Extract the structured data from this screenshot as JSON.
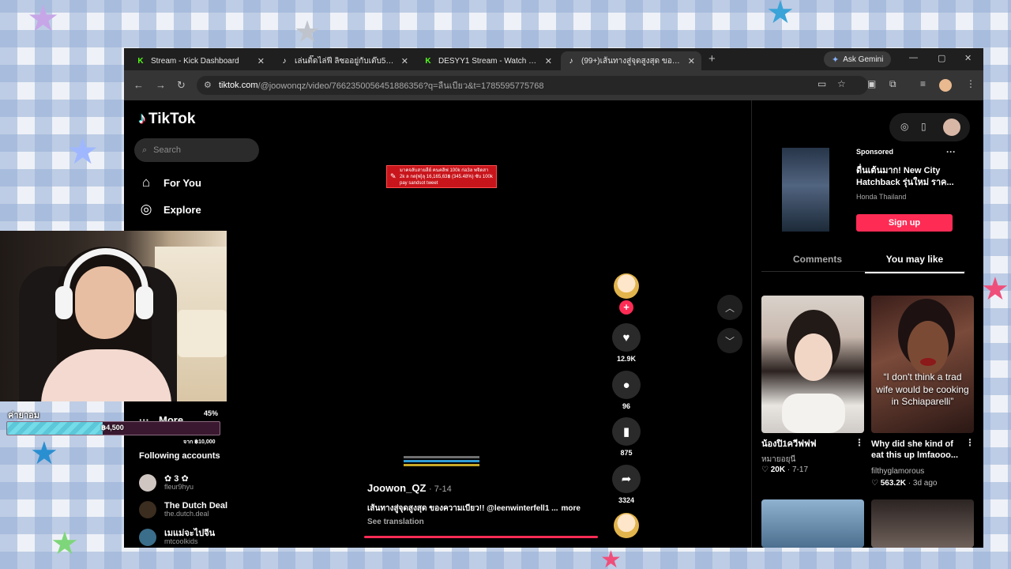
{
  "browser": {
    "tabs": [
      {
        "title": "Stream - Kick Dashboard",
        "favicon": "kick-icon"
      },
      {
        "title": "เล่นติ๊ดไล่ฟี ลิซออยู่กับเต๊บ555#ซาวร",
        "favicon": "tiktok-icon"
      },
      {
        "title": "DESYY1 Stream - Watch Live on",
        "favicon": "kick-icon"
      },
      {
        "title": "(99+)เส้นทางสู่จุดสูงสุด ของความเบี",
        "favicon": "tiktok-icon"
      }
    ],
    "gemini_label": "Ask Gemini",
    "url_host": "tiktok.com",
    "url_path": "/@joowonqz/video/7662350056451886356?q=ลืนเบียว&t=1785595775768"
  },
  "tiktok": {
    "logo_text": "TikTok",
    "search_placeholder": "Search",
    "nav": [
      {
        "label": "For You",
        "icon": "home-icon"
      },
      {
        "label": "Explore",
        "icon": "compass-icon"
      },
      {
        "label": "More",
        "icon": "more-icon"
      }
    ],
    "following_title": "Following accounts",
    "following": [
      {
        "name": "✿ 3 ✿",
        "handle": "fleur9hyu"
      },
      {
        "name": "The Dutch Deal",
        "handle": "the.dutch.deal"
      },
      {
        "name": "เมแม่จะไปจีน",
        "handle": "mtcoolkids"
      }
    ],
    "video": {
      "banner_text": "มาคจลับสายลีย์ คนคลิฟ 100k ก่อ3ล พจิดสา 2k ล กด[ฟ]ลุ 16,165,63฿ (345.48%) ซับ 100k pay sandsot tweet",
      "creator": "Joowon_QZ",
      "date": "· 7-14",
      "caption": "เส้นทางสู่จุดสูงสุด ของความเบียว!! @leenwinterfell1 ...",
      "caption_more": "more",
      "see_translation": "See translation",
      "likes": "12.9K",
      "comments": "96",
      "saves": "875",
      "shares": "3324",
      "stripe_colors": [
        "#6f6f6f",
        "#2e9bd6",
        "#c9a928"
      ]
    },
    "ad": {
      "sponsored": "Sponsored",
      "title": "ดื่นเต้นมาก! New City Hatchback รุ่นใหม่ ราค...",
      "brand": "Honda Thailand",
      "cta": "Sign up"
    },
    "panel_tabs": [
      "Comments",
      "You may like"
    ],
    "cards": [
      {
        "title": "น้องปิ1ควีฟฟฟ",
        "author": "หมายอยุนี",
        "likes": "20K",
        "date": "7-17",
        "overlay": ""
      },
      {
        "title": "Why did she kind of eat this up lmfaooo...",
        "author": "filthyglamorous",
        "likes": "563.2K",
        "date": "3d ago",
        "overlay": "“I don't think a trad wife would be cooking in Schiaparelli”"
      }
    ]
  },
  "stream_overlay": {
    "goal_label": "ค่ายาอม",
    "goal_percent": "45%",
    "goal_fraction": 0.45,
    "goal_amount": "฿4,500",
    "goal_target": "จาก ฿10,000"
  },
  "colors": {
    "accent": "#fe2c55",
    "kick": "#53fc18",
    "goal_fill": "#74dbe8"
  }
}
